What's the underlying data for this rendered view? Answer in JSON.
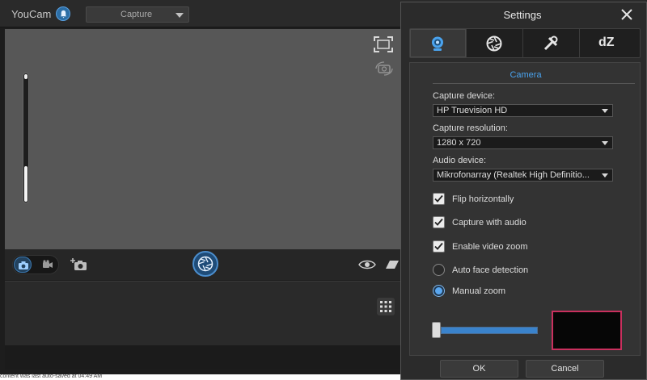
{
  "app": {
    "title": "YouCam",
    "mode_select": "Capture",
    "status_text": "content was last auto-saved at 04:49 AM"
  },
  "settings": {
    "title": "Settings",
    "tabs": [
      {
        "name": "camera",
        "icon": "webcam-icon",
        "selected": true
      },
      {
        "name": "effects",
        "icon": "shutter-icon",
        "selected": false
      },
      {
        "name": "tools",
        "icon": "tools-icon",
        "selected": false
      },
      {
        "name": "dz",
        "label": "dZ",
        "selected": false
      }
    ],
    "section_title": "Camera",
    "capture_device": {
      "label": "Capture device:",
      "value": "HP Truevision HD"
    },
    "capture_resolution": {
      "label": "Capture resolution:",
      "value": "1280 x 720"
    },
    "audio_device": {
      "label": "Audio device:",
      "value": "Mikrofonarray (Realtek High Definitio..."
    },
    "checkboxes": [
      {
        "label": "Flip horizontally",
        "checked": true
      },
      {
        "label": "Capture with audio",
        "checked": true
      },
      {
        "label": "Enable video zoom",
        "checked": true
      }
    ],
    "radios": [
      {
        "label": "Auto face detection",
        "selected": false
      },
      {
        "label": "Manual zoom",
        "selected": true
      }
    ],
    "zoom_level": 1.0,
    "ok_label": "OK",
    "cancel_label": "Cancel"
  },
  "colors": {
    "accent": "#4aa3ee",
    "preview_border": "#c9305e",
    "background": "#2b2b2b"
  }
}
